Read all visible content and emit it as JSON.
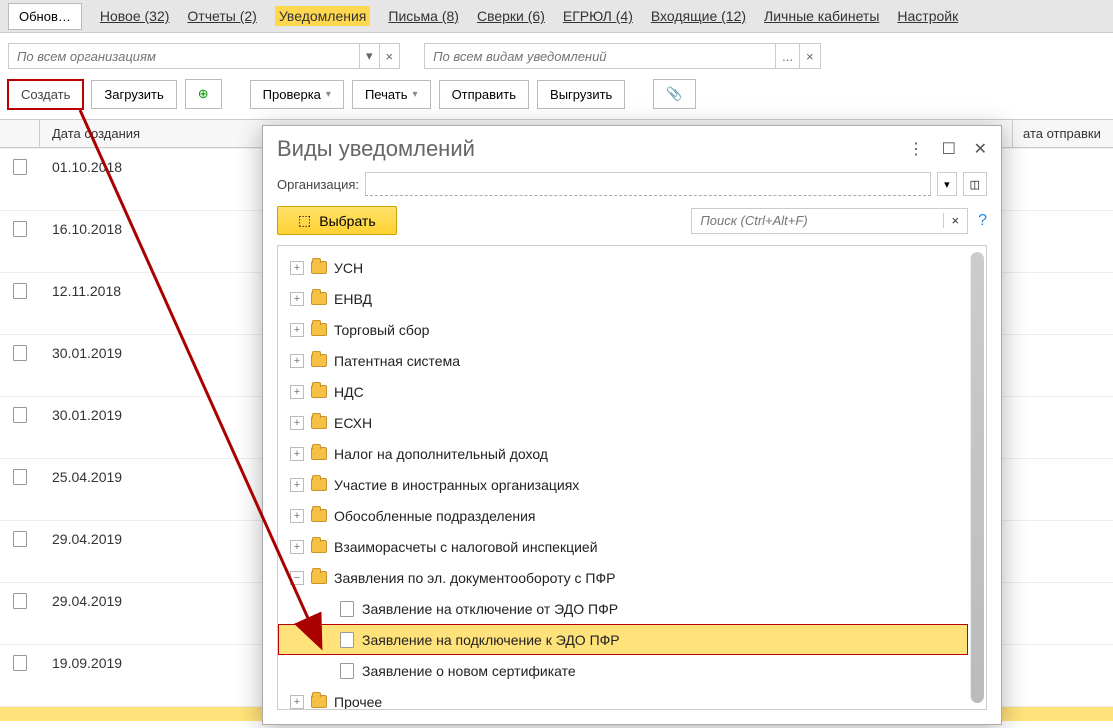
{
  "topbar": {
    "refresh": "Обнов…",
    "links": [
      {
        "label": "Новое (32)"
      },
      {
        "label": "Отчеты (2)"
      },
      {
        "label": "Уведомления",
        "active": true
      },
      {
        "label": "Письма (8)"
      },
      {
        "label": "Сверки (6)"
      },
      {
        "label": "ЕГРЮЛ (4)"
      },
      {
        "label": "Входящие (12)"
      },
      {
        "label": "Личные кабинеты"
      },
      {
        "label": "Настройк"
      }
    ]
  },
  "filters": {
    "org_placeholder": "По всем организациям",
    "kind_placeholder": "По всем видам уведомлений"
  },
  "toolbar": {
    "create": "Создать",
    "load": "Загрузить",
    "check": "Проверка",
    "print": "Печать",
    "send": "Отправить",
    "export": "Выгрузить"
  },
  "table": {
    "col_date": "Дата создания",
    "col_send": "ата отправки",
    "rows": [
      "01.10.2018",
      "16.10.2018",
      "12.11.2018",
      "30.01.2019",
      "30.01.2019",
      "25.04.2019",
      "29.04.2019",
      "29.04.2019",
      "19.09.2019"
    ]
  },
  "dialog": {
    "title": "Виды уведомлений",
    "org_label": "Организация:",
    "select": "Выбрать",
    "search_placeholder": "Поиск (Ctrl+Alt+F)",
    "tree": [
      {
        "t": "folder",
        "label": "УСН"
      },
      {
        "t": "folder",
        "label": "ЕНВД"
      },
      {
        "t": "folder",
        "label": "Торговый сбор"
      },
      {
        "t": "folder",
        "label": "Патентная система"
      },
      {
        "t": "folder",
        "label": "НДС"
      },
      {
        "t": "folder",
        "label": "ЕСХН"
      },
      {
        "t": "folder",
        "label": "Налог на дополнительный доход"
      },
      {
        "t": "folder",
        "label": "Участие в иностранных организациях"
      },
      {
        "t": "folder",
        "label": "Обособленные подразделения"
      },
      {
        "t": "folder",
        "label": "Взаиморасчеты с налоговой инспекцией"
      },
      {
        "t": "folder",
        "expanded": true,
        "label": "Заявления по эл. документообороту с ПФР"
      },
      {
        "t": "leaf",
        "label": "Заявление на отключение от ЭДО ПФР"
      },
      {
        "t": "leaf",
        "hl": true,
        "label": "Заявление на подключение к ЭДО ПФР"
      },
      {
        "t": "leaf",
        "label": "Заявление о новом сертификате"
      },
      {
        "t": "folder",
        "label": "Прочее"
      }
    ]
  }
}
